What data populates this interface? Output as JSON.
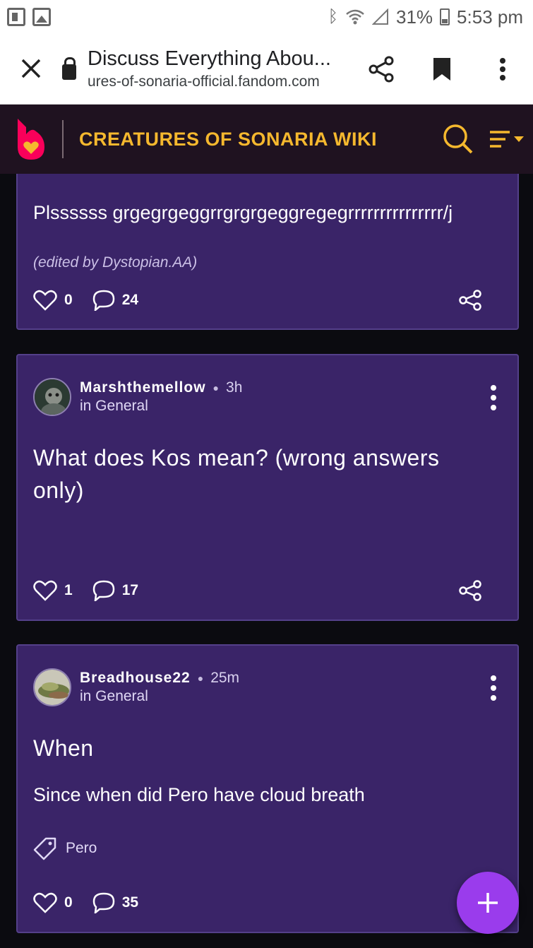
{
  "status_bar": {
    "battery": "31%",
    "time": "5:53 pm",
    "icons": [
      "flipboard-icon",
      "gallery-icon",
      "bluetooth-icon",
      "wifi-icon",
      "signal-icon",
      "battery-icon"
    ]
  },
  "browser": {
    "title": "Discuss Everything Abou...",
    "url": "ures-of-sonaria-official.fandom.com",
    "actions": [
      "share-icon",
      "bookmark-icon",
      "more-icon"
    ]
  },
  "wiki": {
    "title": "CREATURES OF SONARIA WIKI",
    "accent": "#f5b82e",
    "brand": "#fa005a"
  },
  "posts": [
    {
      "body": "Plssssss grgegrgeggrrgrgrgeggregegrrrrrrrrrrrrrrr/j",
      "edited": "(edited by Dystopian.AA)",
      "likes": "0",
      "comments": "24"
    },
    {
      "author": "Marshthemellow",
      "age": "3h",
      "category": "in General",
      "title": "What does Kos mean? (wrong answers only)",
      "likes": "1",
      "comments": "17"
    },
    {
      "author": "Breadhouse22",
      "age": "25m",
      "category": "in General",
      "title": "When",
      "body": "Since when did Pero have cloud breath",
      "tag": "Pero",
      "likes": "0",
      "comments": "35"
    }
  ],
  "fab": {
    "icon": "plus-icon"
  }
}
